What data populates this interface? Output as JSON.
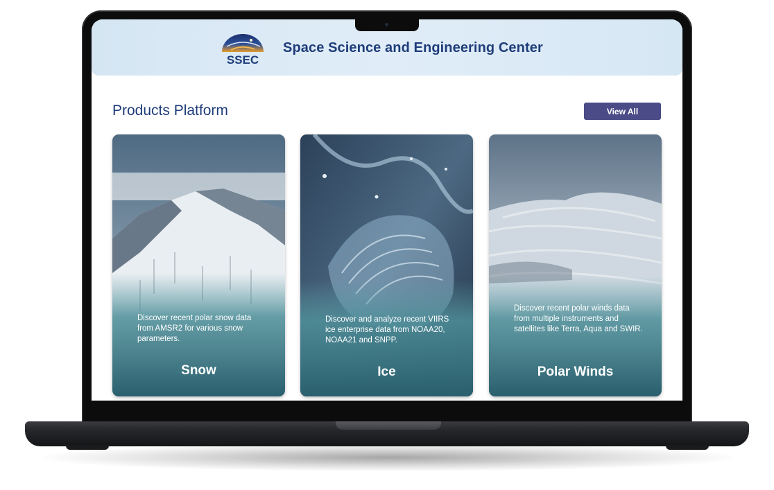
{
  "header": {
    "logo_text": "SSEC",
    "site_title": "Space Science and Engineering Center"
  },
  "products": {
    "section_title": "Products Platform",
    "view_all_label": "View All",
    "cards": [
      {
        "title": "Snow",
        "description": "Discover recent polar snow data from AMSR2 for various snow parameters."
      },
      {
        "title": "Ice",
        "description": "Discover and analyze recent VIIRS ice enterprise data  from NOAA20, NOAA21 and SNPP."
      },
      {
        "title": "Polar Winds",
        "description": "Discover recent polar winds data from multiple instruments and satellites like Terra, Aqua and SWIR."
      }
    ]
  },
  "colors": {
    "brand_blue": "#1f3d7a",
    "button": "#4b4b87",
    "card_teal": "#3a7f8c"
  }
}
